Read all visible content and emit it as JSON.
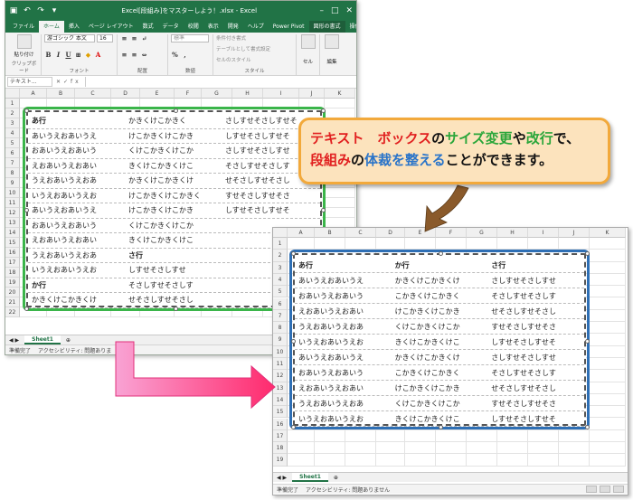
{
  "window1": {
    "title": "Excel[段組み]をマスターしよう！.xlsx - Excel",
    "tabs": [
      "ファイル",
      "ホーム",
      "挿入",
      "ページ レイアウト",
      "数式",
      "データ",
      "校閲",
      "表示",
      "開発",
      "ヘルプ",
      "Power Pivot",
      "図形の書式",
      "操作アシス"
    ],
    "ribbon": {
      "paste_label": "貼り付け",
      "clipboard_label": "クリップボード",
      "font_name": "游ゴシック 本文",
      "font_size": "16",
      "font_group_label": "フォント",
      "align_group_label": "配置",
      "number_format": "標準",
      "number_group_label": "数値",
      "cond_format": "条件付き書式",
      "table_format": "テーブルとして書式設定",
      "cell_style": "セルのスタイル",
      "style_group_label": "スタイル",
      "cells_label": "セル",
      "edit_label": "編集"
    },
    "name_box": "テキスト...",
    "columns": [
      "A",
      "B",
      "C",
      "D",
      "E",
      "F",
      "G",
      "H",
      "I",
      "J",
      "K"
    ],
    "rows": [
      "1",
      "2",
      "3",
      "4",
      "5",
      "6",
      "7",
      "8",
      "9",
      "10",
      "11",
      "12",
      "13",
      "14",
      "15",
      "16",
      "17",
      "18",
      "19",
      "20",
      "21",
      "22"
    ],
    "textbox_lines": [
      [
        "あ行",
        "かきくけこかきく",
        "さしすせそさしすせそ"
      ],
      [
        "あいうえおあいうえ",
        "けこかきくけこかき",
        "しすせそさしすせそ"
      ],
      [
        "おあいうえおあいう",
        "くけこかきくけこか",
        "さしすせそさしすせ"
      ],
      [
        "えおあいうえおあい",
        "きくけこかきくけこ",
        "そさしすせそさしす"
      ],
      [
        "うえおあいうえおあ",
        "かきくけこかきくけ",
        "せそさしすせそさし"
      ],
      [
        "いうえおあいうえお",
        "けこかきくけこかきく",
        "すせそさしすせそさ"
      ],
      [
        "あいうえおあいうえ",
        "けこかきくけこかき",
        "しすせそさしすせそ"
      ],
      [
        "おあいうえおあいう",
        "くけこかきくけこか",
        ""
      ],
      [
        "えおあいうえおあい",
        "きくけこかきくけこ",
        ""
      ],
      [
        "うえおあいうえおあ",
        "さ行",
        ""
      ],
      [
        "いうえおあいうえお",
        "しすせそさしすせ",
        ""
      ],
      [
        "か行",
        "そさしすせそさしす",
        ""
      ],
      [
        "かきくけこかきくけ",
        "せそさしすせそさし",
        ""
      ]
    ],
    "sheet_tab": "Sheet1",
    "status_ready": "準備完了",
    "status_accessibility": "アクセシビリティ: 問題ありま"
  },
  "callout": {
    "parts": [
      {
        "text": "テキスト　ボックス",
        "color": "#e12020"
      },
      {
        "text": "の",
        "color": "#111111"
      },
      {
        "text": "サイズ変更",
        "color": "#2aa63a"
      },
      {
        "text": "や",
        "color": "#111111"
      },
      {
        "text": "改行",
        "color": "#2aa63a"
      },
      {
        "text": "で、",
        "color": "#111111"
      }
    ],
    "parts2": [
      {
        "text": "段組み",
        "color": "#e12020"
      },
      {
        "text": "の",
        "color": "#111111"
      },
      {
        "text": "体裁を整える",
        "color": "#2a74c9"
      },
      {
        "text": "ことができます。",
        "color": "#111111"
      }
    ]
  },
  "window2": {
    "columns": [
      "A",
      "B",
      "C",
      "D",
      "E",
      "F",
      "G",
      "H",
      "I",
      "J",
      "K"
    ],
    "rows": [
      "1",
      "2",
      "3",
      "4",
      "5",
      "6",
      "7",
      "8",
      "9",
      "10",
      "11",
      "12",
      "13",
      "14",
      "15",
      "16",
      "17",
      "18",
      "19"
    ],
    "textbox_lines": [
      [
        "あ行",
        "か行",
        "さ行"
      ],
      [
        "あいうえおあいうえ",
        "かきくけこかきくけ",
        "さしすせそさしすせ"
      ],
      [
        "おあいうえおあいう",
        "こかきくけこかきく",
        "そさしすせそさしす"
      ],
      [
        "えおあいうえおあい",
        "けこかきくけこかき",
        "せそさしすせそさし"
      ],
      [
        "うえおあいうえおあ",
        "くけこかきくけこか",
        "すせそさしすせそさ"
      ],
      [
        "いうえおあいうえお",
        "きくけこかきくけこ",
        "しすせそさしすせそ"
      ],
      [
        "あいうえおあいうえ",
        "かきくけこかきくけ",
        "さしすせそさしすせ"
      ],
      [
        "おあいうえおあいう",
        "こかきくけこかきく",
        "そさしすせそさしす"
      ],
      [
        "えおあいうえおあい",
        "けこかきくけこかき",
        "せそさしすせそさし"
      ],
      [
        "うえおあいうえおあ",
        "くけこかきくけこか",
        "すせそさしすせそさ"
      ],
      [
        "いうえおあいうえお",
        "きくけこかきくけこ",
        "しすせそさしすせそ"
      ]
    ],
    "sheet_tab": "Sheet1",
    "status_ready": "準備完了",
    "status_accessibility": "アクセシビリティ: 問題ありません"
  },
  "colors": {
    "excel_green": "#217346",
    "textbox1_outline": "#3bb54a",
    "textbox2_outline": "#2e6fb5",
    "callout_bg": "#fce3bd",
    "callout_border": "#f2a93b",
    "arrow_pink": "#ff3d8e"
  }
}
